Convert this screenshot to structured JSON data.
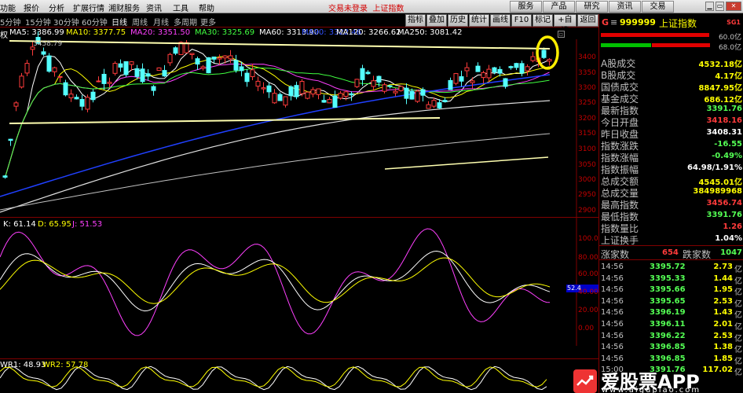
{
  "menu": {
    "items": [
      "功能",
      "报价",
      "分析",
      "扩展行情",
      "湘财服务",
      "资讯",
      "工具",
      "帮助"
    ],
    "trade_status": "交易未登录",
    "stock_title": "上证指数",
    "top_buttons": [
      "服务",
      "产品",
      "研究",
      "资讯",
      "交易"
    ]
  },
  "periods": {
    "tabs": [
      "5分钟",
      "15分钟",
      "30分钟",
      "60分钟",
      "日线",
      "周线",
      "月线",
      "多周期",
      "更多"
    ],
    "active": "日线"
  },
  "right_buttons": [
    "指标",
    "叠加",
    "历史",
    "统计",
    "画线",
    "F10",
    "标记",
    "+自选",
    "返回"
  ],
  "colors": {
    "bg": "#000000",
    "up": "#ff3b3b",
    "down": "#54ffff",
    "ma5": "#ffffff",
    "ma10": "#ffff00",
    "ma20": "#ff40ff",
    "ma30": "#40ff40",
    "ma60": "#c0c0c0",
    "ma90": "#2040ff",
    "ma120": "#e0e0e0",
    "ma250": "#ffffa0",
    "highlight": "#ffee00"
  },
  "ma_legend": {
    "prefix": "权",
    "items": [
      {
        "label": "MA5: 3386.99",
        "color": "#ffffff"
      },
      {
        "label": "MA10: 3377.75",
        "color": "#ffff00"
      },
      {
        "label": "MA20: 3351.50",
        "color": "#ff40ff"
      },
      {
        "label": "MA30: 3325.69",
        "color": "#40ff40"
      },
      {
        "label": "MA60: 3313.90",
        "color": "#ffffff"
      },
      {
        "label": "MA90: 3322.46",
        "color": "#3050ff"
      },
      {
        "label": "MA120: 3266.62",
        "color": "#ffffff"
      },
      {
        "label": "MA250: 3081.42",
        "color": "#ffffff"
      }
    ]
  },
  "price_axis": {
    "labels": [
      "3400",
      "3350",
      "3300",
      "3250",
      "3200",
      "3150",
      "3100",
      "3050",
      "3000",
      "2950",
      "2900"
    ],
    "high_annotation": "3458.79"
  },
  "kdj": {
    "legend": [
      {
        "label": "K: 61.14",
        "color": "#ffffff"
      },
      {
        "label": "D: 65.95",
        "color": "#ffff00"
      },
      {
        "label": "J: 51.53",
        "color": "#ff40ff"
      }
    ],
    "axis": [
      "100.00",
      "80.00",
      "60.00",
      "40.00",
      "20.00",
      "0.00"
    ],
    "current_tag": "52.4"
  },
  "wr": {
    "legend": [
      {
        "label": "WR1: 48.93",
        "color": "#ffffff"
      },
      {
        "label": "WR2: 57.78",
        "color": "#ffff00"
      }
    ]
  },
  "quote": {
    "market_letter": "G",
    "code": "999999",
    "name": "上证指数",
    "tag": "SG1",
    "bars": [
      {
        "label": "60.0亿"
      },
      {
        "label": "68.0亿"
      }
    ],
    "rows": [
      {
        "label": "A股成交",
        "value": "4532.18亿",
        "color": "#ffff00"
      },
      {
        "label": "B股成交",
        "value": "4.17亿",
        "color": "#ffff00"
      },
      {
        "label": "国债成交",
        "value": "8847.95亿",
        "color": "#ffff00"
      },
      {
        "label": "基金成交",
        "value": "686.12亿",
        "color": "#ffff00"
      },
      {
        "label": "最新指数",
        "value": "3391.76",
        "color": "#54ff54"
      },
      {
        "label": "今日开盘",
        "value": "3418.16",
        "color": "#ff3b3b"
      },
      {
        "label": "昨日收盘",
        "value": "3408.31",
        "color": "#ffffff"
      },
      {
        "label": "指数涨跌",
        "value": "-16.55",
        "color": "#54ff54"
      },
      {
        "label": "指数涨幅",
        "value": "-0.49%",
        "color": "#54ff54"
      },
      {
        "label": "指数振幅",
        "value": "64.98/1.91%",
        "color": "#ffffff"
      },
      {
        "label": "总成交额",
        "value": "4545.01亿",
        "color": "#ffff00"
      },
      {
        "label": "总成交量",
        "value": "384989968",
        "color": "#ffff00"
      },
      {
        "label": "最高指数",
        "value": "3456.74",
        "color": "#ff3b3b"
      },
      {
        "label": "最低指数",
        "value": "3391.76",
        "color": "#54ff54"
      },
      {
        "label": "指数量比",
        "value": "1.26",
        "color": "#ff3b3b"
      },
      {
        "label": "上证换手",
        "value": "1.04%",
        "color": "#ffffff"
      }
    ],
    "breadth": {
      "up_label": "涨家数",
      "up_value": "654",
      "down_label": "跌家数",
      "down_value": "1047"
    },
    "ticks": [
      {
        "time": "14:56",
        "price": "3395.72",
        "vol": "2.73",
        "unit": "亿"
      },
      {
        "time": "14:56",
        "price": "3395.33",
        "vol": "1.44",
        "unit": "亿"
      },
      {
        "time": "14:56",
        "price": "3395.66",
        "vol": "1.95",
        "unit": "亿"
      },
      {
        "time": "14:56",
        "price": "3395.65",
        "vol": "2.53",
        "unit": "亿"
      },
      {
        "time": "14:56",
        "price": "3396.19",
        "vol": "1.43",
        "unit": "亿"
      },
      {
        "time": "14:56",
        "price": "3396.11",
        "vol": "2.01",
        "unit": "亿"
      },
      {
        "time": "14:56",
        "price": "3396.22",
        "vol": "2.53",
        "unit": "亿"
      },
      {
        "time": "14:56",
        "price": "3396.85",
        "vol": "1.38",
        "unit": "亿"
      },
      {
        "time": "14:56",
        "price": "3396.85",
        "vol": "1.85",
        "unit": "亿"
      },
      {
        "time": "15:00",
        "price": "3391.76",
        "vol": "117.02",
        "unit": "亿"
      }
    ]
  },
  "watermark": {
    "brand": "爱股票",
    "brand_suffix": "APP",
    "url": "www.aigupiao.com"
  }
}
